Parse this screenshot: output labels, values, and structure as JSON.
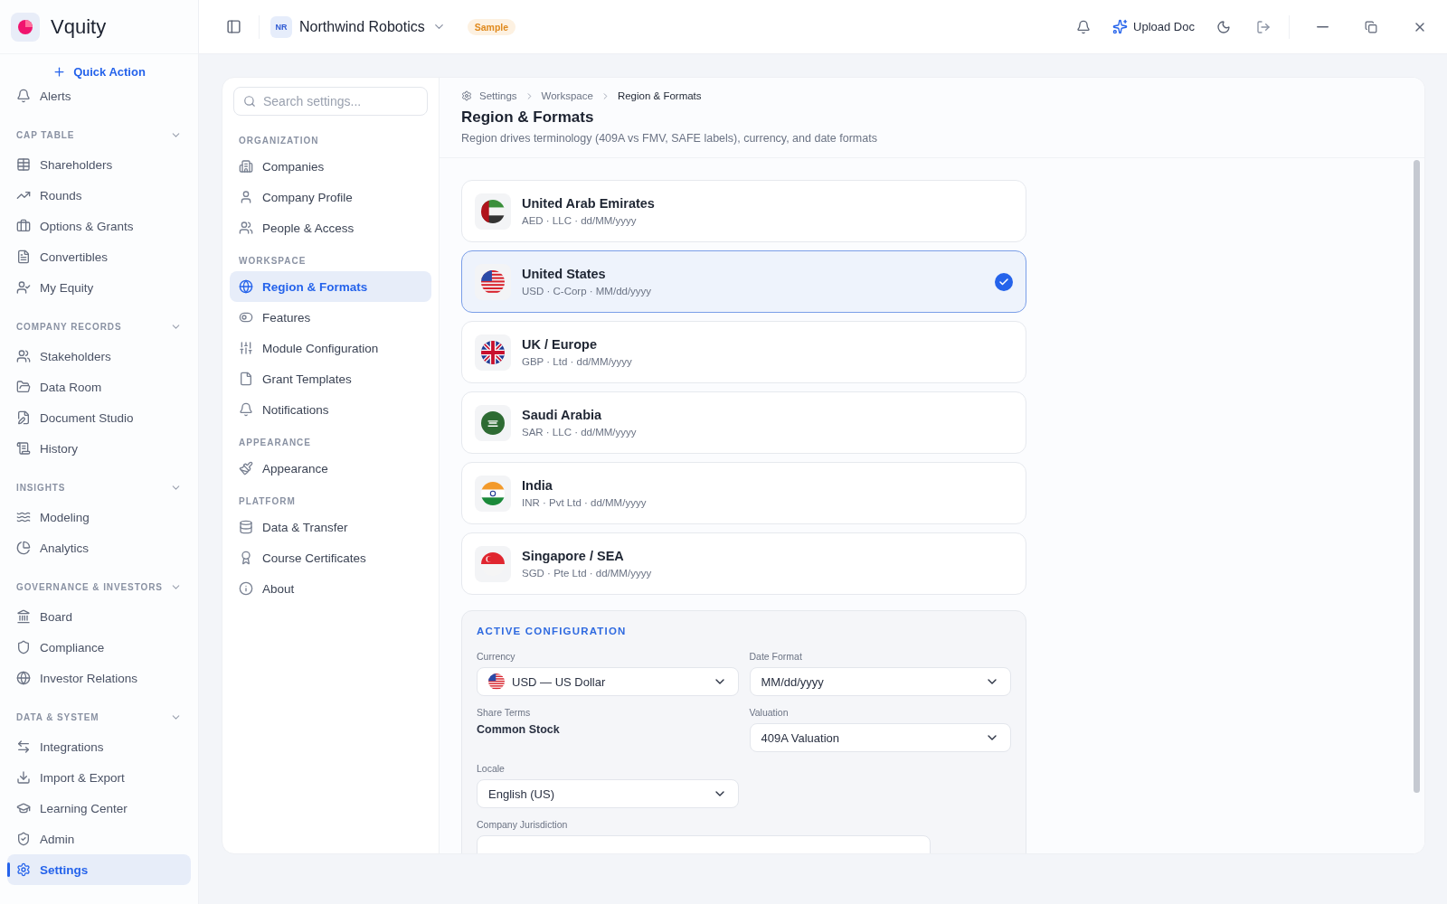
{
  "app": {
    "name": "Vquity"
  },
  "quick_action": "Quick Action",
  "sidebar": {
    "top_item": {
      "label": "Alerts"
    },
    "sections": [
      {
        "title": "CAP TABLE",
        "expanded": true,
        "items": [
          {
            "label": "Shareholders",
            "selected": false
          },
          {
            "label": "Rounds",
            "selected": false
          },
          {
            "label": "Options & Grants",
            "selected": false
          },
          {
            "label": "Convertibles",
            "selected": false
          },
          {
            "label": "My Equity",
            "selected": false
          }
        ]
      },
      {
        "title": "COMPANY RECORDS",
        "expanded": true,
        "items": [
          {
            "label": "Stakeholders",
            "selected": false
          },
          {
            "label": "Data Room",
            "selected": false
          },
          {
            "label": "Document Studio",
            "selected": false
          },
          {
            "label": "History",
            "selected": false
          }
        ]
      },
      {
        "title": "INSIGHTS",
        "expanded": true,
        "items": [
          {
            "label": "Modeling",
            "selected": false
          },
          {
            "label": "Analytics",
            "selected": false
          }
        ]
      },
      {
        "title": "GOVERNANCE & INVESTORS",
        "expanded": true,
        "items": [
          {
            "label": "Board",
            "selected": false
          },
          {
            "label": "Compliance",
            "selected": false
          },
          {
            "label": "Investor Relations",
            "selected": false
          }
        ]
      },
      {
        "title": "DATA & SYSTEM",
        "expanded": true,
        "items": [
          {
            "label": "Integrations",
            "selected": false
          },
          {
            "label": "Import & Export",
            "selected": false
          },
          {
            "label": "Learning Center",
            "selected": false
          },
          {
            "label": "Admin",
            "selected": false
          },
          {
            "label": "Settings",
            "selected": true
          }
        ]
      }
    ]
  },
  "topbar": {
    "company_initials": "NR",
    "company_name": "Northwind Robotics",
    "badge": "Sample",
    "upload_button": "Upload Doc"
  },
  "settings_nav": {
    "search": {
      "placeholder": "Search settings..."
    },
    "groups": [
      {
        "title": "ORGANIZATION",
        "items": [
          {
            "label": "Companies",
            "selected": false
          },
          {
            "label": "Company Profile",
            "selected": false
          },
          {
            "label": "People & Access",
            "selected": false
          }
        ]
      },
      {
        "title": "WORKSPACE",
        "items": [
          {
            "label": "Region & Formats",
            "selected": true
          },
          {
            "label": "Features",
            "selected": false
          },
          {
            "label": "Module Configuration",
            "selected": false
          },
          {
            "label": "Grant Templates",
            "selected": false
          },
          {
            "label": "Notifications",
            "selected": false
          }
        ]
      },
      {
        "title": "APPEARANCE",
        "items": [
          {
            "label": "Appearance",
            "selected": false
          }
        ]
      },
      {
        "title": "PLATFORM",
        "items": [
          {
            "label": "Data & Transfer",
            "selected": false
          },
          {
            "label": "Course Certificates",
            "selected": false
          },
          {
            "label": "About",
            "selected": false
          }
        ]
      }
    ]
  },
  "breadcrumb": [
    "Settings",
    "Workspace",
    "Region & Formats"
  ],
  "page_title": "Region & Formats",
  "page_subtitle": "Region drives terminology (409A vs FMV, SAFE labels), currency, and date formats",
  "regions": [
    {
      "name": "United Arab Emirates",
      "details": "AED · LLC · dd/MM/yyyy",
      "selected": false
    },
    {
      "name": "United States",
      "details": "USD · C-Corp · MM/dd/yyyy",
      "selected": true
    },
    {
      "name": "UK / Europe",
      "details": "GBP · Ltd · dd/MM/yyyy",
      "selected": false
    },
    {
      "name": "Saudi Arabia",
      "details": "SAR · LLC · dd/MM/yyyy",
      "selected": false
    },
    {
      "name": "India",
      "details": "INR · Pvt Ltd · dd/MM/yyyy",
      "selected": false
    },
    {
      "name": "Singapore / SEA",
      "details": "SGD · Pte Ltd · dd/MM/yyyy",
      "selected": false
    }
  ],
  "active_configuration": {
    "title": "ACTIVE CONFIGURATION",
    "fields": [
      {
        "label": "Currency",
        "kind": "currency-select",
        "value": "USD — US Dollar"
      },
      {
        "label": "Date Format",
        "kind": "select",
        "value": "MM/dd/yyyy"
      },
      {
        "label": "Share Terms",
        "kind": "text",
        "value": "Common Stock"
      },
      {
        "label": "Valuation",
        "kind": "select",
        "value": "409A Valuation"
      },
      {
        "label": "Locale",
        "kind": "select",
        "value": "English (US)"
      },
      {
        "label": "Company Jurisdiction",
        "kind": "wide-select"
      }
    ]
  }
}
